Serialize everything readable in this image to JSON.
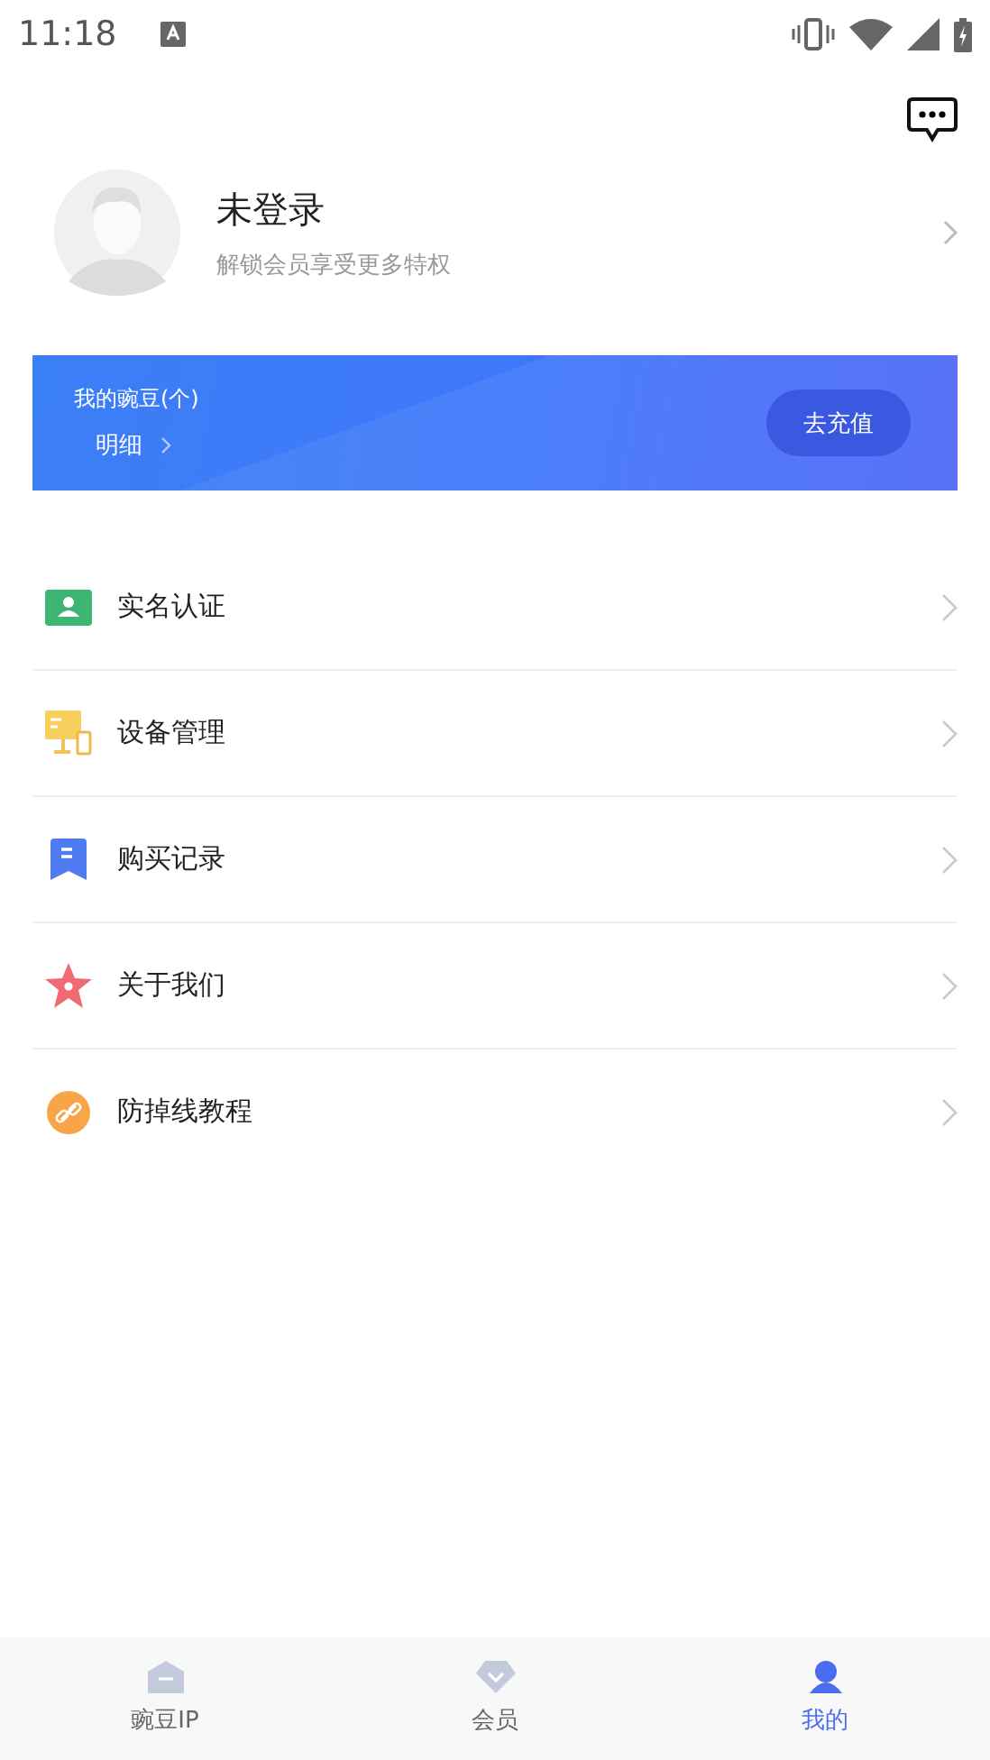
{
  "status_bar": {
    "time": "11:18"
  },
  "profile": {
    "name": "未登录",
    "subtitle": "解锁会员享受更多特权"
  },
  "wallet": {
    "label": "我的豌豆(个)",
    "detail_link": "明细",
    "recharge_button": "去充值"
  },
  "menu": [
    {
      "kind": "id-card",
      "label": "实名认证"
    },
    {
      "kind": "devices",
      "label": "设备管理"
    },
    {
      "kind": "bookmark",
      "label": "购买记录"
    },
    {
      "kind": "star",
      "label": "关于我们"
    },
    {
      "kind": "link",
      "label": "防掉线教程"
    }
  ],
  "tabs": [
    {
      "kind": "home",
      "label": "豌豆IP",
      "selected": false
    },
    {
      "kind": "diamond",
      "label": "会员",
      "selected": false
    },
    {
      "kind": "person",
      "label": "我的",
      "selected": true
    }
  ]
}
